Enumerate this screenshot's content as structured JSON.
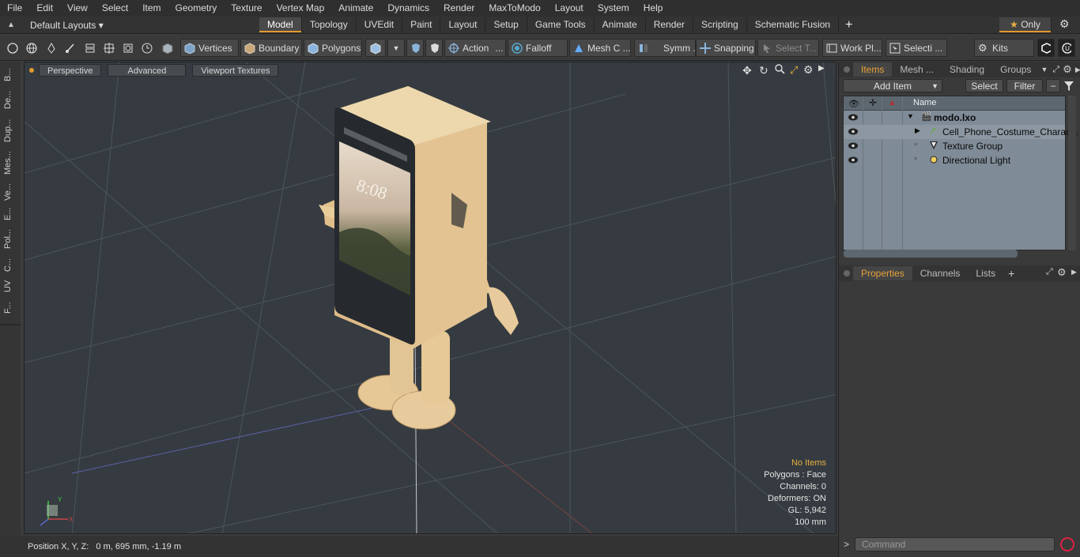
{
  "menu": [
    "File",
    "Edit",
    "View",
    "Select",
    "Item",
    "Geometry",
    "Texture",
    "Vertex Map",
    "Animate",
    "Dynamics",
    "Render",
    "MaxToModo",
    "Layout",
    "System",
    "Help"
  ],
  "layout_menu": "Default Layouts",
  "layout_tabs": [
    "Model",
    "Topology",
    "UVEdit",
    "Paint",
    "Layout",
    "Setup",
    "Game Tools",
    "Animate",
    "Render",
    "Scripting",
    "Schematic Fusion"
  ],
  "active_layout_tab": "Model",
  "only_label": "Only",
  "toolbar": {
    "vertices": "Vertices",
    "boundary": "Boundary",
    "polygons": "Polygons",
    "action": "Action",
    "falloff": "Falloff",
    "mesh_c": "Mesh C ...",
    "symm": "Symm ...",
    "snapping": "Snapping",
    "select_t": "Select T...",
    "work_pl": "Work Pl...",
    "selecti": "Selecti ...",
    "kits": "Kits"
  },
  "left_tabs": [
    "B...",
    "De...",
    "Dup...",
    "Mes...",
    "Ve...",
    "E...",
    "Pol...",
    "C...",
    "UV",
    "F..."
  ],
  "viewport": {
    "buttons": [
      "Perspective",
      "Advanced",
      "Viewport Textures"
    ],
    "info": {
      "no_items": "No Items",
      "polygons": "Polygons : Face",
      "channels": "Channels: 0",
      "deformers": "Deformers: ON",
      "gl": "GL: 5,942",
      "scale": "100 mm"
    },
    "phone_time": "8:08"
  },
  "status": "Position X, Y, Z:   0 m, 695 mm, -1.19 m",
  "right": {
    "top_tabs": [
      "Items",
      "Mesh ...",
      "Shading",
      "Groups"
    ],
    "add_item": "Add Item",
    "select": "Select",
    "filter": "Filter",
    "name_header": "Name",
    "items": [
      "modo.lxo",
      "Cell_Phone_Costume_Charac...",
      "Texture Group",
      "Directional Light"
    ],
    "bottom_tabs": [
      "Properties",
      "Channels",
      "Lists"
    ],
    "command_placeholder": "Command"
  }
}
